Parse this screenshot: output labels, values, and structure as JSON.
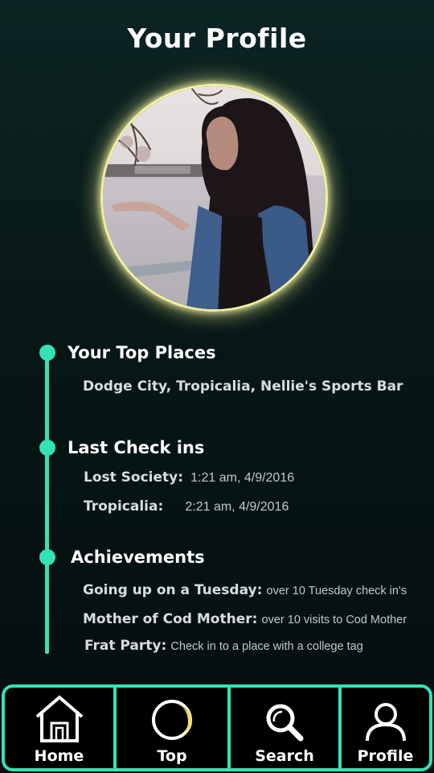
{
  "header": {
    "title": "Your Profile"
  },
  "profile": {
    "photo_alt": "Profile photo"
  },
  "sections": {
    "top_places": {
      "title": "Your Top Places",
      "text": "Dodge City, Tropicalia, Nellie's Sports Bar"
    },
    "last_checkins": {
      "title": "Last Check ins",
      "items": [
        {
          "place": "Lost Society:",
          "time": "1:21 am, 4/9/2016"
        },
        {
          "place": "Tropicalia:",
          "time": "2:21 am, 4/9/2016"
        }
      ]
    },
    "achievements": {
      "title": "Achievements",
      "items": [
        {
          "name": "Going up on a Tuesday",
          "sep": ":",
          "desc": "over 10 Tuesday check in's"
        },
        {
          "name": "Mother of Cod Mother:",
          "sep": "",
          "desc": "over 10 visits to Cod Mother"
        },
        {
          "name": "Frat Party",
          "sep": ":",
          "desc": "Check in to a place with a college tag"
        }
      ]
    }
  },
  "navbar": {
    "items": [
      {
        "label": "Home",
        "icon": "house-icon"
      },
      {
        "label": "Top",
        "icon": "moon-icon"
      },
      {
        "label": "Search",
        "icon": "magnifier-icon"
      },
      {
        "label": "Profile",
        "icon": "person-icon"
      }
    ]
  },
  "colors": {
    "accent": "#33e3b4",
    "avatar_ring": "#f3f0a2",
    "background_top": "#0b2423",
    "background_bottom": "#050d0e"
  }
}
